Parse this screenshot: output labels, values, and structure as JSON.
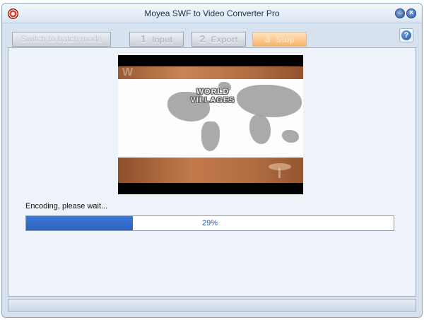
{
  "window": {
    "title": "Moyea SWF to Video Converter Pro",
    "minimize_glyph": "–",
    "close_glyph": "×"
  },
  "toolbar": {
    "batch_label": "Switch to batch mode",
    "steps": [
      {
        "num": "1",
        "label": "Input"
      },
      {
        "num": "2",
        "label": "Export"
      },
      {
        "num": "3",
        "label": "Stop"
      }
    ],
    "help_glyph": "?"
  },
  "preview": {
    "title_line1": "WORLD",
    "title_line2": "VILLAGES",
    "watermark": "W"
  },
  "status": {
    "message": "Encoding, please wait...",
    "progress_percent": 29,
    "progress_label": "29%"
  },
  "colors": {
    "accent": "#2d63bf",
    "stop_button": "#f9b36b"
  },
  "icons": [
    "app-logo-icon",
    "minimize-icon",
    "close-icon",
    "help-icon"
  ]
}
